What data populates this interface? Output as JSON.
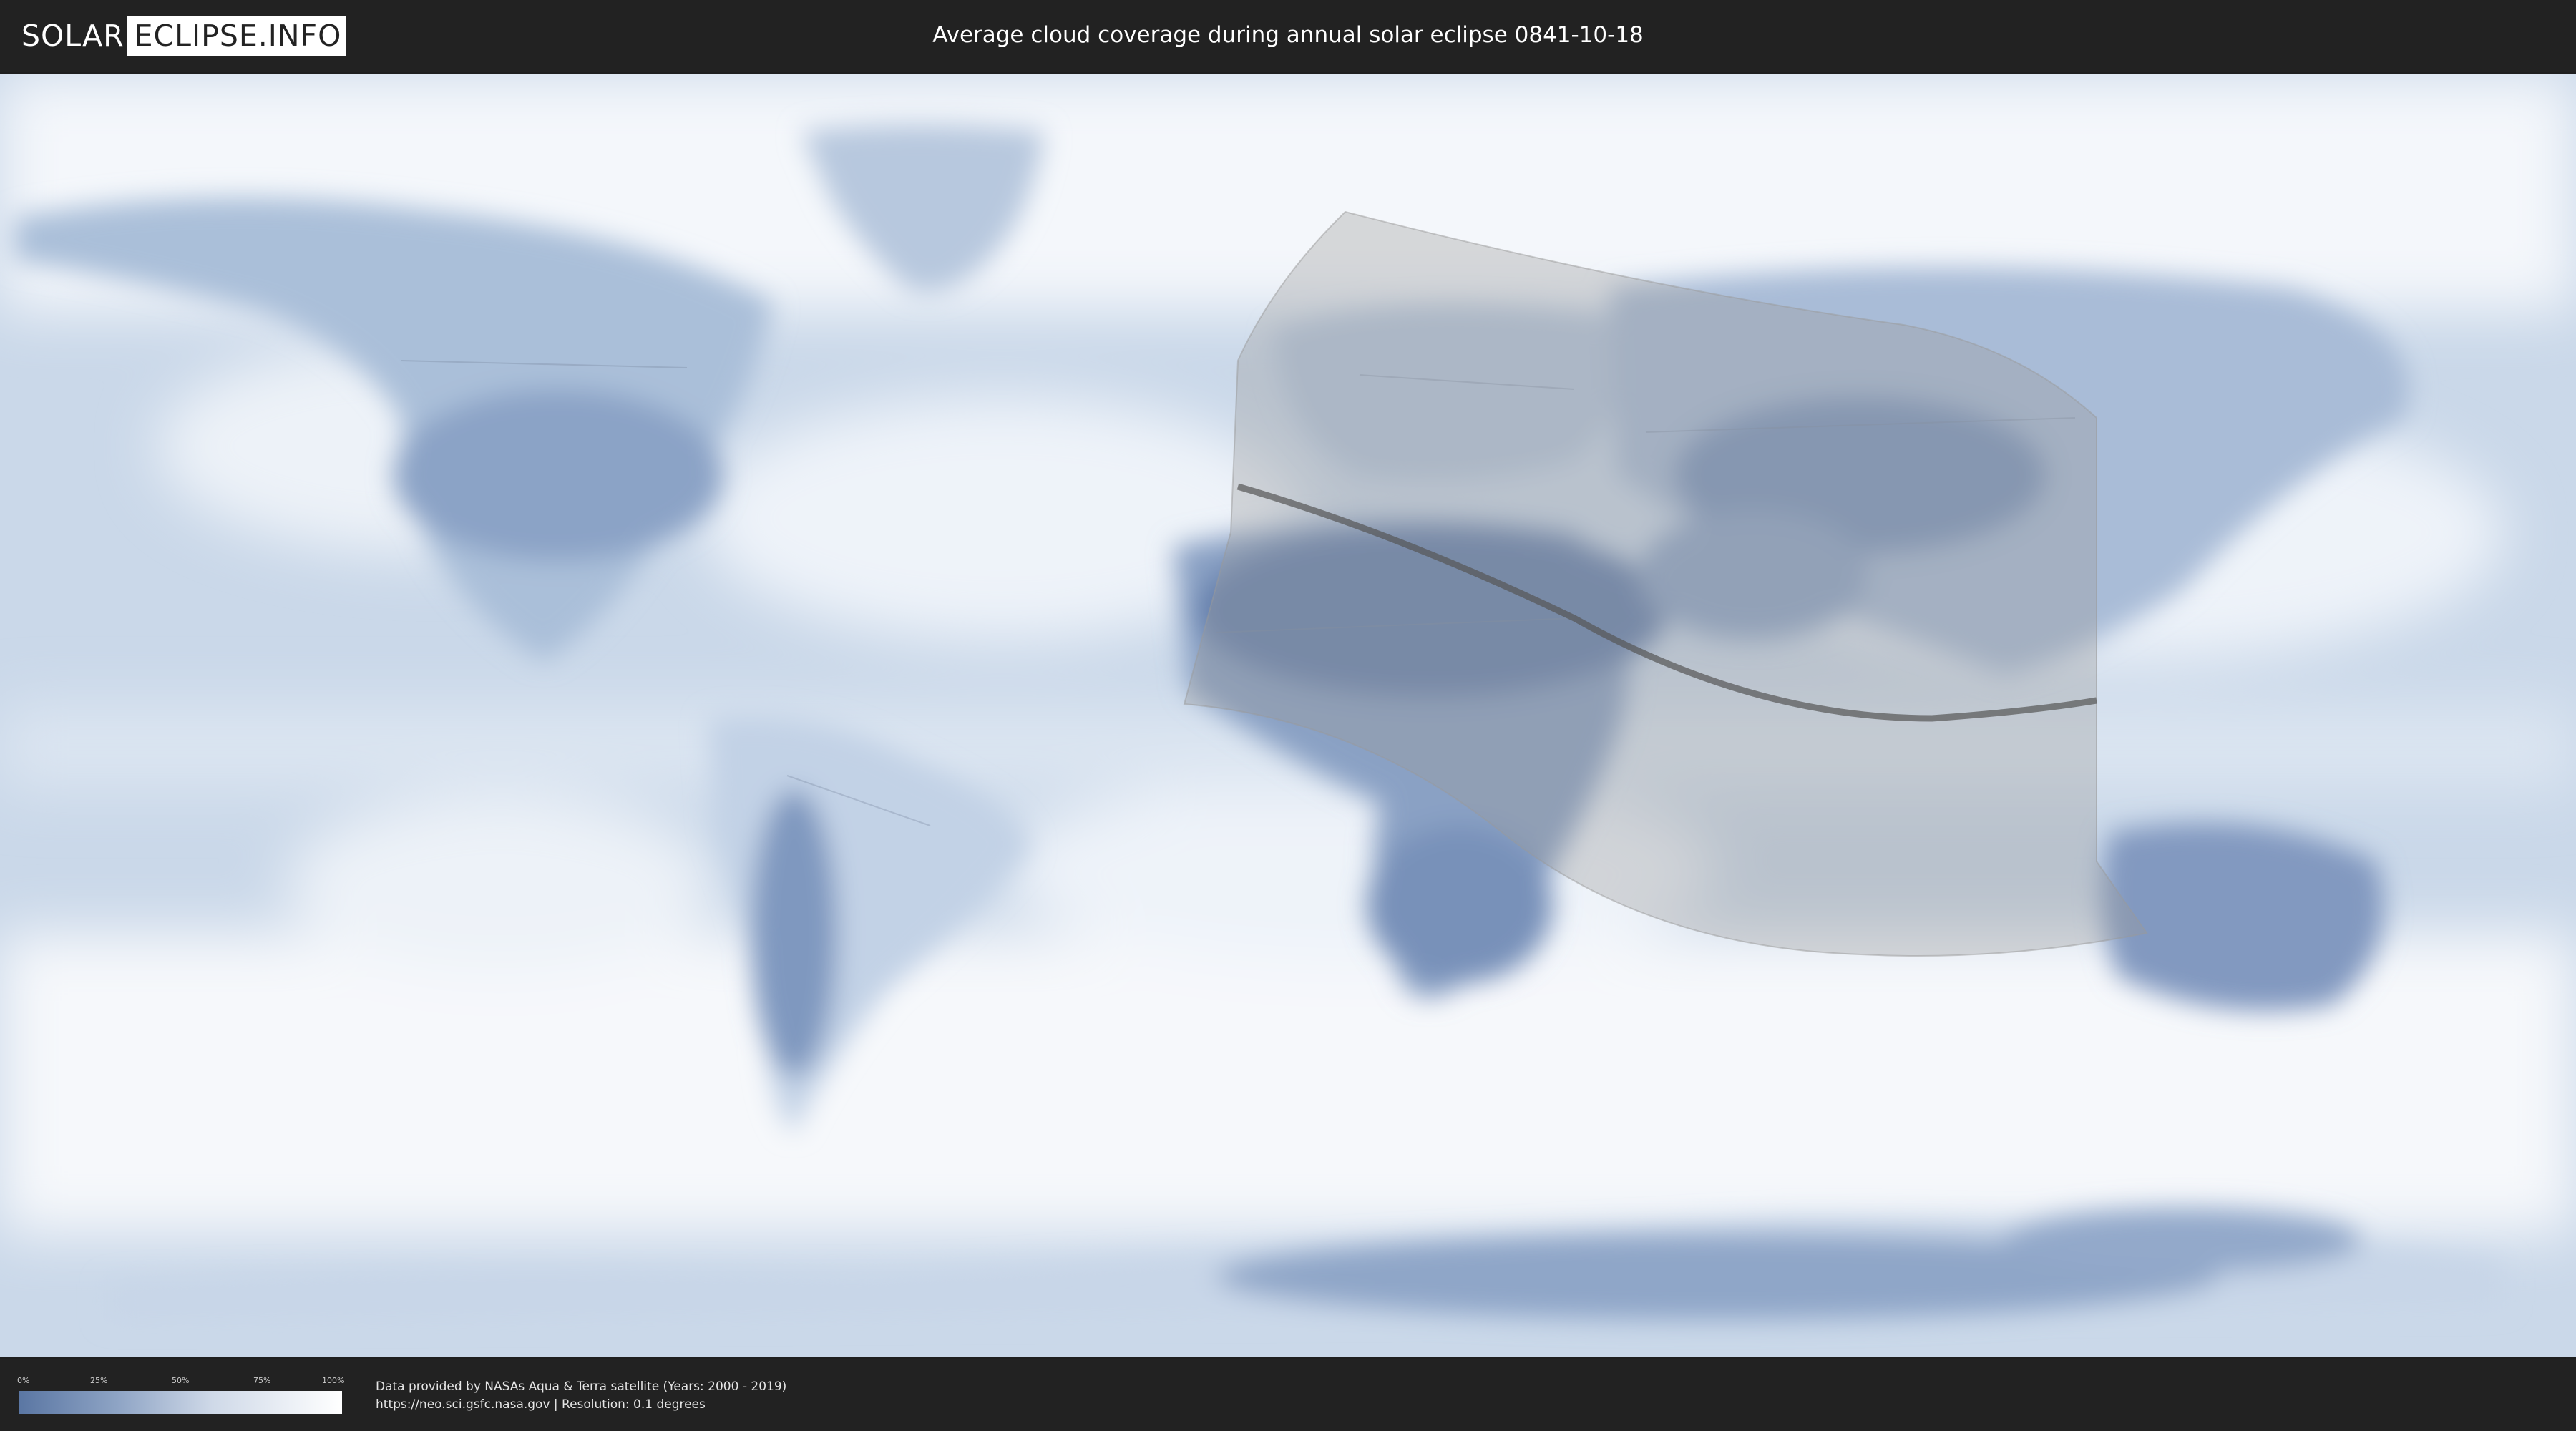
{
  "header": {
    "logo_left": "SOLAR",
    "logo_right": "ECLIPSE.INFO",
    "title": "Average cloud coverage during annual solar eclipse 0841-10-18"
  },
  "legend": {
    "ticks": [
      "0%",
      "25%",
      "50%",
      "75%",
      "100%"
    ],
    "colors": {
      "low": "#5a76a3",
      "high": "#ffffff"
    }
  },
  "footer": {
    "credit_line1": "Data provided by NASAs Aqua & Terra satellite (Years: 2000 - 2019)",
    "credit_line2": "https://neo.sci.gsfc.nasa.gov | Resolution: 0.1 degrees"
  },
  "map": {
    "projection": "equirectangular",
    "base_color": "#c9d7e8",
    "cloud_color": "#ffffff",
    "clear_sky_color": "#5d78a5",
    "eclipse_overlay_color": "#9a9a9a",
    "central_line_color": "#555555"
  }
}
